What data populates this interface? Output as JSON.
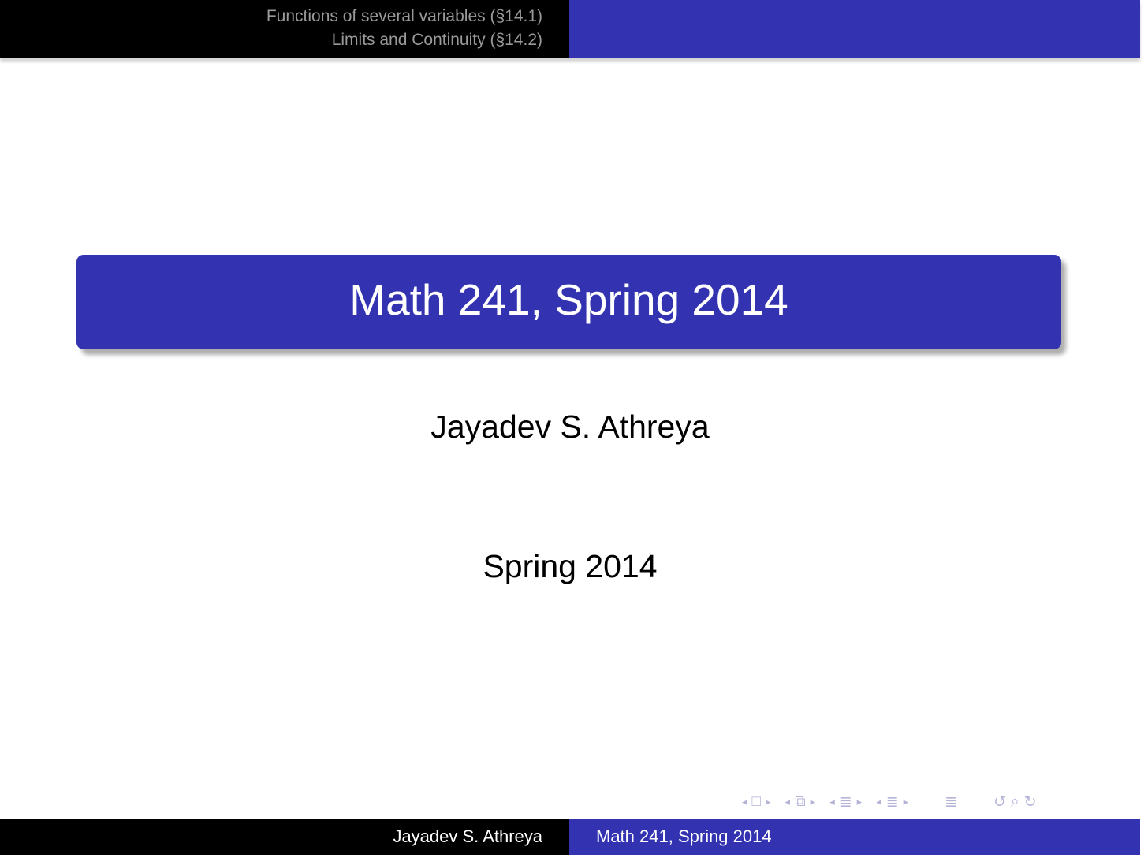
{
  "header": {
    "sections": [
      "Functions of several variables (§14.1)",
      "Limits and Continuity (§14.2)"
    ]
  },
  "title_slide": {
    "title": "Math 241, Spring 2014",
    "author": "Jayadev S. Athreya",
    "date": "Spring 2014"
  },
  "footer": {
    "author": "Jayadev S. Athreya",
    "title": "Math 241, Spring 2014"
  },
  "navigation": {
    "icons": [
      "frame-prev-arrow-icon",
      "frame-icon",
      "frame-next-arrow-icon",
      "subsection-prev-arrow-icon",
      "subsection-icon",
      "subsection-next-arrow-icon",
      "section-prev-arrow-icon",
      "section-icon",
      "section-next-arrow-icon",
      "presentation-prev-arrow-icon",
      "presentation-icon",
      "presentation-next-arrow-icon",
      "appendix-icon",
      "back-icon",
      "search-icon",
      "forward-icon"
    ]
  },
  "colors": {
    "beamer_blue": "#3333b2",
    "header_black": "#000000",
    "section_text_gray": "#9a9a9a",
    "nav_symbol_color": "#b4b4d8"
  }
}
